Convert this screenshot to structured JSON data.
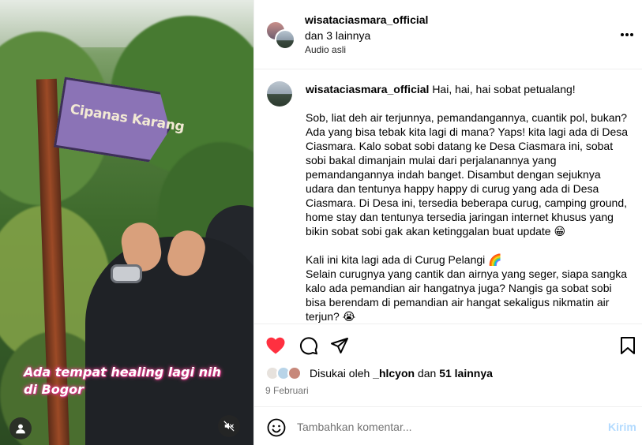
{
  "media": {
    "sign_text": "Cipanas Karang",
    "caption_line1": "Ada tempat healing lagi nih",
    "caption_line2": "di Bogor",
    "user_icon": "person-icon",
    "mute_icon": "speaker-muted-icon"
  },
  "header": {
    "username": "wisataciasmara_official",
    "collab": "dan 3 lainnya",
    "audio": "Audio asli",
    "more_icon": "more-horizontal-icon"
  },
  "caption": {
    "username": "wisataciasmara_official",
    "intro": "Hai, hai, hai sobat petualang!",
    "paragraph1": "Sob, liat deh air terjunnya, pemandangannya, cuantik pol, bukan? Ada yang bisa tebak kita lagi di mana? Yaps! kita lagi ada di Desa Ciasmara. Kalo sobat sobi datang ke Desa Ciasmara ini, sobat sobi bakal dimanjain mulai dari perjalanannya yang pemandangannya indah banget. Disambut dengan sejuknya udara dan tentunya happy happy di curug yang ada di Desa Ciasmara. Di Desa ini, tersedia beberapa curug, camping ground, home stay dan tentunya tersedia jaringan internet khusus yang bikin sobat sobi gak akan ketinggalan buat update 😁",
    "paragraph2_line1": "Kali ini kita lagi ada di Curug Pelangi 🌈",
    "paragraph2_rest": "Selain curugnya yang cantik dan airnya yang seger, siapa sangka kalo ada pemandian air hangatnya juga? Nangis ga sobat sobi bisa berendam di pemandian air hangat sekaligus nikmatin air terjun? 😭"
  },
  "actions": {
    "like_icon": "heart-filled-icon",
    "comment_icon": "comment-bubble-icon",
    "share_icon": "paper-plane-icon",
    "save_icon": "bookmark-icon",
    "like_color": "#ff3040"
  },
  "likes": {
    "prefix": "Disukai oleh",
    "user": "_hlcyon",
    "middle": "dan",
    "count": "51 lainnya"
  },
  "date": "9 Februari",
  "comment_box": {
    "placeholder": "Tambahkan komentar...",
    "send_label": "Kirim",
    "emoji_icon": "smiley-icon"
  }
}
